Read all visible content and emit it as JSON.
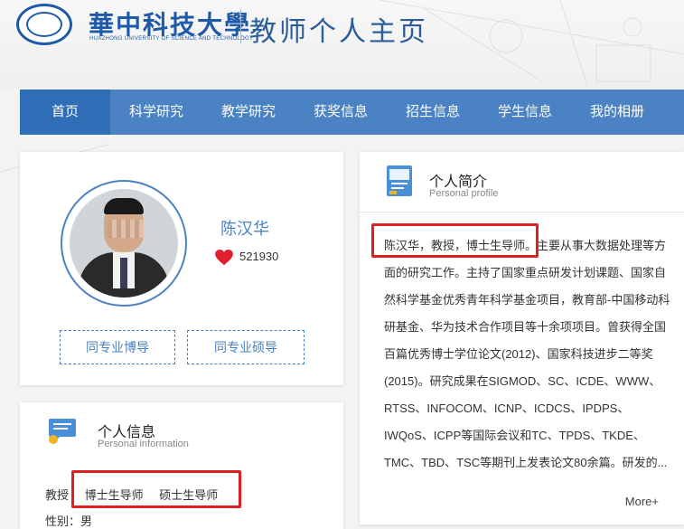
{
  "header": {
    "university_cn": "華中科技大學",
    "university_en": "HUAZHONG UNIVERSITY OF SCIENCE AND TECHNOLOGY",
    "site_title": "教师个人主页"
  },
  "nav": {
    "items": [
      "首页",
      "科学研究",
      "教学研究",
      "获奖信息",
      "招生信息",
      "学生信息",
      "我的相册"
    ],
    "active": "首页"
  },
  "profile": {
    "name": "陈汉华",
    "likes": "521930",
    "btn_phd": "同专业博导",
    "btn_master": "同专业硕导"
  },
  "info": {
    "title": "个人信息",
    "subtitle": "Personal information",
    "rank": "教授",
    "tags": [
      "博士生导师",
      "硕士生导师"
    ],
    "gender_label": "性别：",
    "gender": "男"
  },
  "bio": {
    "title": "个人简介",
    "subtitle": "Personal profile",
    "text": "陈汉华，教授，博士生导师。主要从事大数据处理等方面的研究工作。主持了国家重点研发计划课题、国家自然科学基金优秀青年科学基金项目，教育部-中国移动科研基金、华为技术合作项目等十余项项目。曾获得全国百篇优秀博士学位论文(2012)、国家科技进步二等奖(2015)。研究成果在SIGMOD、SC、ICDE、WWW、RTSS、INFOCOM、ICNP、ICDCS、IPDPS、IWQoS、ICPP等国际会议和TC、TPDS、TKDE、TMC、TBD、TSC等期刊上发表论文80余篇。研发的...",
    "more": "More+"
  },
  "colors": {
    "nav_bg": "#4a82c4",
    "nav_active": "#2f6db6",
    "brand_blue": "#1e5aa8",
    "highlight_red": "#e02020",
    "heart_red": "#e0202e"
  }
}
